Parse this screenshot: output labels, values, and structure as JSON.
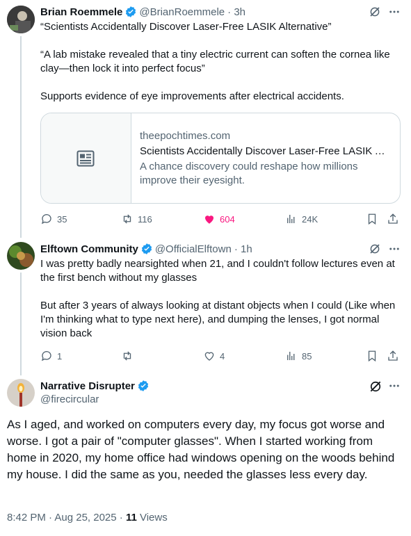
{
  "tweets": [
    {
      "name": "Brian Roemmele",
      "handle": "@BrianRoemmele",
      "time": "· 3h",
      "paragraphs": [
        "“Scientists Accidentally Discover Laser-Free LASIK Alternative”",
        "“A lab mistake revealed that a tiny electric current can soften the cornea like clay—then lock it into perfect focus”",
        "Supports evidence of eye improvements after electrical accidents."
      ],
      "card": {
        "domain": "theepochtimes.com",
        "title": "Scientists Accidentally Discover Laser-Free LASIK Alternative",
        "description": "A chance discovery could reshape how millions improve their eyesight.",
        "thumb_icon": "article-icon"
      },
      "actions": {
        "replies": "35",
        "reposts": "116",
        "likes": "604",
        "views": "24K"
      }
    },
    {
      "name": "Elftown Community",
      "handle": "@OfficialElftown",
      "time": "· 1h",
      "paragraphs": [
        "I was pretty badly nearsighted when 21, and I couldn't follow lectures even at the first bench without my glasses",
        "But after 3 years of always looking at distant objects when I could (Like when I'm thinking what to type next here), and dumping the lenses, I got normal vision back"
      ],
      "actions": {
        "replies": "1",
        "reposts": "",
        "likes": "4",
        "views": "85"
      }
    }
  ],
  "main_tweet": {
    "name": "Narrative Disrupter",
    "handle": "@firecircular",
    "text": "As I aged, and worked on computers every day, my focus got worse and worse. I got a pair of \"computer glasses\". When I started working from home in 2020, my home office had windows opening on the woods behind my house. I did the same as you, needed the glasses less every day.",
    "timestamp": "8:42 PM · Aug 25, 2025 · ",
    "views_count": "11",
    "views_label": " Views"
  },
  "colors": {
    "like_active": "#f91880",
    "verified": "#1d9bf0",
    "muted": "#536471",
    "border": "#cfd9de"
  }
}
